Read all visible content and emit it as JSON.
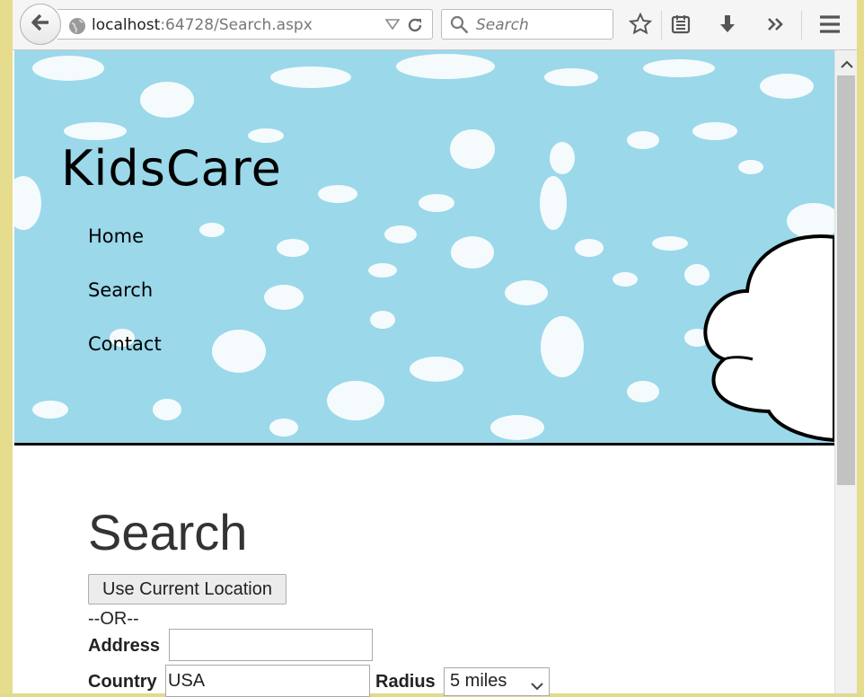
{
  "browser": {
    "url_host": "localhost",
    "url_path": ":64728/Search.aspx",
    "search_placeholder": "Search"
  },
  "site": {
    "title": "KidsCare",
    "nav": [
      "Home",
      "Search",
      "Contact"
    ]
  },
  "search_page": {
    "heading": "Search",
    "use_location_label": "Use Current Location",
    "or_text": "--OR--",
    "address_label": "Address",
    "address_value": "",
    "country_label": "Country",
    "country_value": "USA",
    "radius_label": "Radius",
    "radius_value": "5 miles"
  },
  "colors": {
    "sky": "#9bd8ea",
    "frame": "#e6dc8e"
  }
}
